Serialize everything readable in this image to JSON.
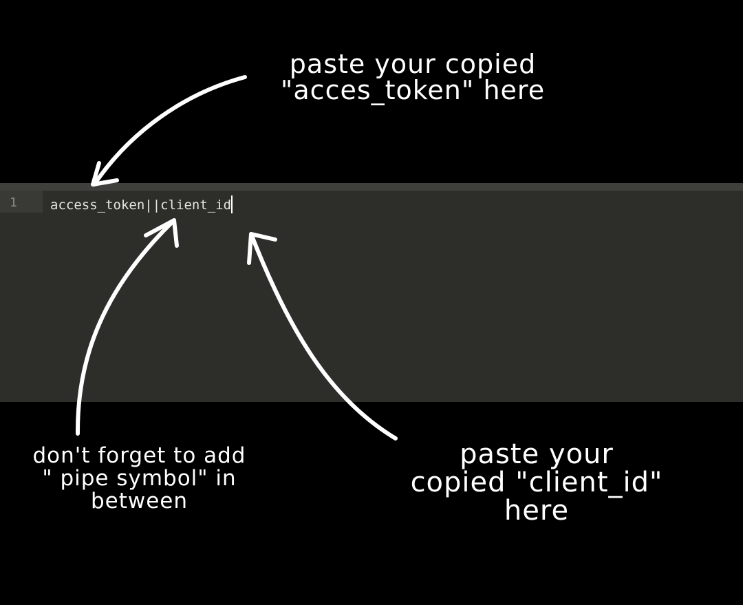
{
  "editor": {
    "line_number": "1",
    "line_text": "access_token||client_id",
    "background_color": "#2d2d29"
  },
  "annotations": {
    "top": [
      "paste your copied",
      "\"acces_token\" here"
    ],
    "left": [
      "don't forget to add",
      "\" pipe symbol\" in",
      "between"
    ],
    "right": [
      "paste your",
      "copied \"client_id\"",
      "here"
    ]
  },
  "colors": {
    "page_background": "#000000",
    "annotation_text": "#ffffff",
    "arrow": "#ffffff"
  },
  "icons": [
    "arrow-to-access-token-icon",
    "arrow-to-pipe-symbol-icon",
    "arrow-to-client-id-icon"
  ]
}
